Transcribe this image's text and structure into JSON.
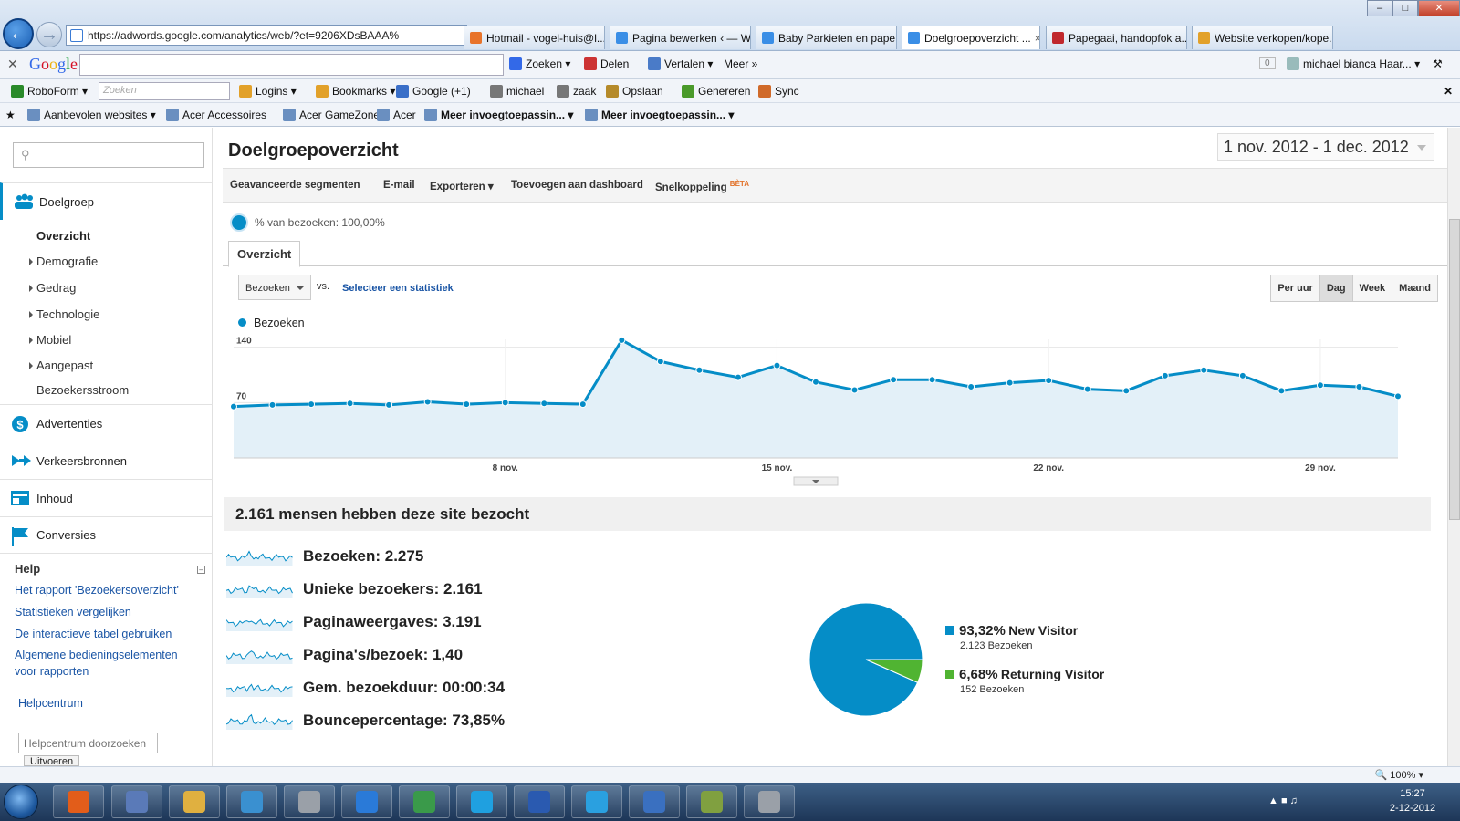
{
  "browser": {
    "url": "https://adwords.google.com/analytics/web/?et=9206XDsBAAA%",
    "tabs": [
      {
        "label": "Hotmail - vogel-huis@l...",
        "color": "#e8732a"
      },
      {
        "label": "Pagina bewerken ‹ — W...",
        "color": "#3a8ee6"
      },
      {
        "label": "Baby Parkieten en pape...",
        "color": "#3a8ee6"
      },
      {
        "label": "Doelgroepoverzicht ...",
        "color": "#3a8ee6"
      },
      {
        "label": "Papegaai, handopfok a...",
        "color": "#c0282d"
      },
      {
        "label": "Website verkopen/kope...",
        "color": "#e2a12a"
      }
    ],
    "active_tab": 3,
    "google_toolbar": {
      "logo": "Google",
      "items": [
        "Zoeken",
        "Delen",
        "Vertalen",
        "Meer »"
      ],
      "counter": "0",
      "user": "michael  bianca Haar..."
    },
    "roboform_bar": {
      "roboform": "RoboForm",
      "search_placeholder": "Zoeken",
      "items": [
        "Logins",
        "Bookmarks",
        "Google (+1)",
        "michael",
        "zaak",
        "Opslaan",
        "Genereren",
        "Sync"
      ]
    },
    "favorites_bar": [
      "Aanbevolen websites",
      "Acer Accessoires",
      "Acer GameZone",
      "Acer",
      "Meer invoegtoepassin...",
      "Meer invoegtoepassin..."
    ],
    "zoom": "100%"
  },
  "sidebar": {
    "sections": [
      {
        "label": "Doelgroep",
        "active": true
      },
      {
        "label": "Advertenties"
      },
      {
        "label": "Verkeersbronnen"
      },
      {
        "label": "Inhoud"
      },
      {
        "label": "Conversies"
      }
    ],
    "subitems": [
      "Overzicht",
      "Demografie",
      "Gedrag",
      "Technologie",
      "Mobiel",
      "Aangepast",
      "Bezoekersstroom"
    ],
    "help": {
      "title": "Help",
      "links": [
        "Het rapport 'Bezoekersoverzicht'",
        "Statistieken vergelijken",
        "De interactieve tabel gebruiken",
        "Algemene bedieningselementen voor rapporten"
      ],
      "center": "Helpcentrum",
      "search_placeholder": "Helpcentrum doorzoeken",
      "search_button": "Uitvoeren"
    }
  },
  "report": {
    "title": "Doelgroepoverzicht",
    "date_range": "1 nov. 2012 - 1 dec. 2012",
    "toolbar": [
      "Geavanceerde segmenten",
      "E-mail",
      "Exporteren",
      "Toevoegen aan dashboard",
      "Snelkoppeling"
    ],
    "beta": "BÈTA",
    "segment": "% van bezoeken: 100,00%",
    "tab": "Overzicht",
    "metric": "Bezoeken",
    "vs": "vs.",
    "select_stat": "Selecteer een statistiek",
    "granularity": [
      "Per uur",
      "Dag",
      "Week",
      "Maand"
    ],
    "granularity_selected": "Dag",
    "summary_title": "2.161 mensen hebben deze site bezocht",
    "metrics": [
      "Bezoeken: 2.275",
      "Unieke bezoekers: 2.161",
      "Paginaweergaves: 3.191",
      "Pagina's/bezoek: 1,40",
      "Gem. bezoekduur: 00:00:34",
      "Bouncepercentage: 73,85%"
    ],
    "visitor_split": [
      {
        "pct": "93,32%",
        "name": "New Visitor",
        "sub": "2.123 Bezoeken",
        "color": "#058dc7",
        "value": 93.32
      },
      {
        "pct": "6,68%",
        "name": "Returning Visitor",
        "sub": "152 Bezoeken",
        "color": "#50b432",
        "value": 6.68
      }
    ]
  },
  "chart_data": {
    "type": "area",
    "series": [
      {
        "name": "Bezoeken",
        "color": "#058dc7",
        "x": [
          "1 nov.",
          "2 nov.",
          "3 nov.",
          "4 nov.",
          "5 nov.",
          "6 nov.",
          "7 nov.",
          "8 nov.",
          "9 nov.",
          "10 nov.",
          "11 nov.",
          "12 nov.",
          "13 nov.",
          "14 nov.",
          "15 nov.",
          "16 nov.",
          "17 nov.",
          "18 nov.",
          "19 nov.",
          "20 nov.",
          "21 nov.",
          "22 nov.",
          "23 nov.",
          "24 nov.",
          "25 nov.",
          "26 nov.",
          "27 nov.",
          "28 nov.",
          "29 nov.",
          "30 nov.",
          "1 dec."
        ],
        "values": [
          65,
          67,
          68,
          69,
          67,
          71,
          68,
          70,
          69,
          68,
          149,
          122,
          111,
          102,
          117,
          96,
          86,
          99,
          99,
          90,
          95,
          98,
          87,
          85,
          104,
          111,
          104,
          85,
          92,
          90,
          78
        ]
      }
    ],
    "y_ticks": [
      70,
      140
    ],
    "x_tick_labels": [
      "8 nov.",
      "15 nov.",
      "22 nov.",
      "29 nov."
    ],
    "ylim": [
      0,
      140
    ],
    "grid": true,
    "legend": "top-left"
  },
  "taskbar": {
    "time": "15:27",
    "date": "2-12-2012"
  }
}
